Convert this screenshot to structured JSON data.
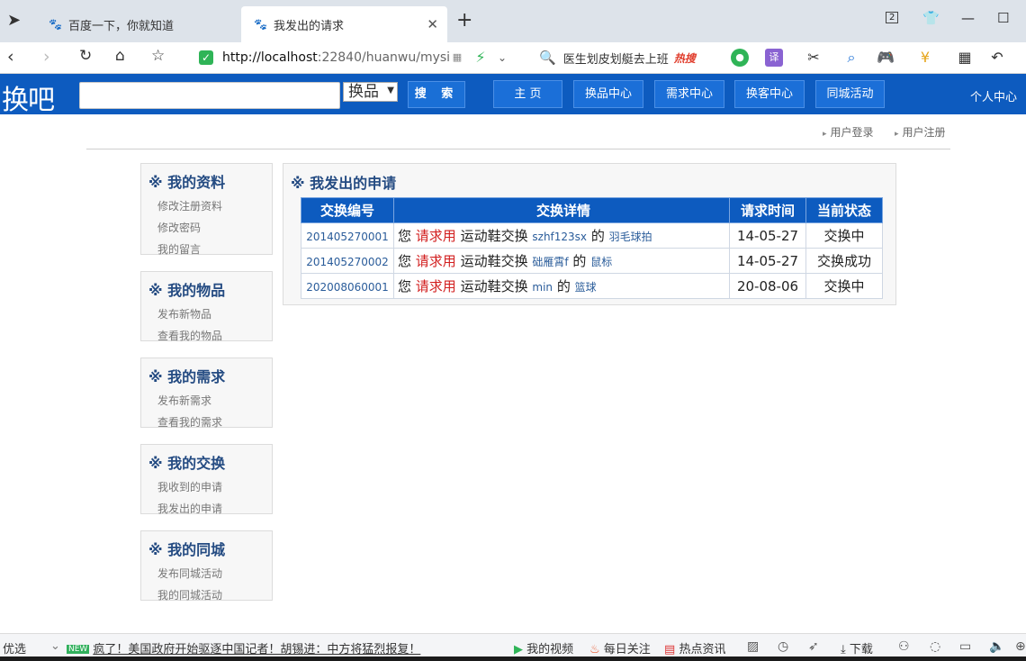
{
  "browser": {
    "tabs": [
      {
        "title": "百度一下，你就知道",
        "active": false
      },
      {
        "title": "我发出的请求",
        "active": true
      }
    ],
    "url_host": "http://localhost",
    "url_rest": ":22840/huanwu/mysi",
    "search_suggestion": "医生划皮划艇去上班",
    "search_hot_label": "热搜",
    "tab_count_badge": "2"
  },
  "site": {
    "logo_text": "换吧",
    "search_placeholder": "",
    "category_selected": "换品",
    "search_button": "搜 索",
    "nav": [
      "主 页",
      "换品中心",
      "需求中心",
      "换客中心",
      "同城活动"
    ],
    "user_center": "个人中心",
    "login_link": "用户登录",
    "register_link": "用户注册"
  },
  "sidebar": [
    {
      "title": "※ 我的资料",
      "links": [
        "修改注册资料",
        "修改密码",
        "我的留言"
      ]
    },
    {
      "title": "※ 我的物品",
      "links": [
        "发布新物品",
        "查看我的物品"
      ]
    },
    {
      "title": "※ 我的需求",
      "links": [
        "发布新需求",
        "查看我的需求"
      ]
    },
    {
      "title": "※ 我的交换",
      "links": [
        "我收到的申请",
        "我发出的申请"
      ]
    },
    {
      "title": "※ 我的同城",
      "links": [
        "发布同城活动",
        "我的同城活动"
      ]
    }
  ],
  "main": {
    "title": "※ 我发出的申请",
    "columns": [
      "交换编号",
      "交换详情",
      "请求时间",
      "当前状态"
    ],
    "rows": [
      {
        "id": "201405270001",
        "prefix": "您",
        "action": "请求用",
        "item": "运动鞋交换",
        "user": "szhf123sx",
        "of": "的",
        "target": "羽毛球拍",
        "time": "14-05-27",
        "status": "交换中"
      },
      {
        "id": "201405270002",
        "prefix": "您",
        "action": "请求用",
        "item": "运动鞋交换",
        "user": "础雁霄f",
        "of": "的",
        "target": "鼠标",
        "time": "14-05-27",
        "status": "交换成功"
      },
      {
        "id": "202008060001",
        "prefix": "您",
        "action": "请求用",
        "item": "运动鞋交换",
        "user": "min",
        "of": "的",
        "target": "篮球",
        "time": "20-08-06",
        "status": "交换中"
      }
    ]
  },
  "statusbar": {
    "left_label": "优选",
    "new_badge": "NEW",
    "news": "疯了！美国政府开始驱逐中国记者！胡锡进：中方将猛烈报复！",
    "my_video": "我的视频",
    "daily_follow": "每日关注",
    "hot_news": "热点资讯",
    "download": "下载"
  }
}
